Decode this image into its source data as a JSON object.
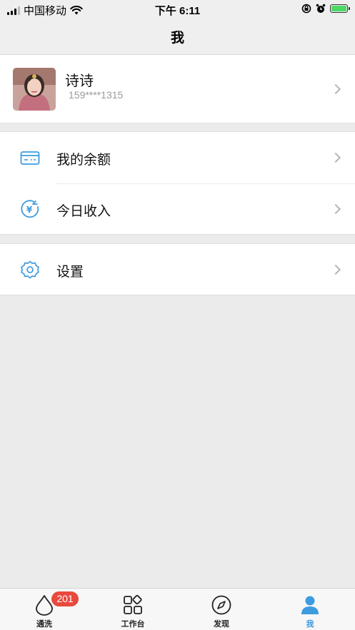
{
  "status_bar": {
    "carrier": "中国移动",
    "time": "下午 6:11"
  },
  "nav": {
    "title": "我"
  },
  "profile": {
    "name": "诗诗",
    "phone": "159****1315"
  },
  "menu": {
    "balance_label": "我的余额",
    "income_label": "今日收入",
    "settings_label": "设置"
  },
  "tabs": [
    {
      "label": "通洗",
      "icon": "drop-icon",
      "badge": "201"
    },
    {
      "label": "工作台",
      "icon": "grid-icon"
    },
    {
      "label": "发现",
      "icon": "compass-icon"
    },
    {
      "label": "我",
      "icon": "person-icon",
      "active": true
    }
  ],
  "colors": {
    "accent": "#3d9be0",
    "badge": "#e8493d",
    "background": "#ebebeb",
    "battery": "#4cd964"
  }
}
